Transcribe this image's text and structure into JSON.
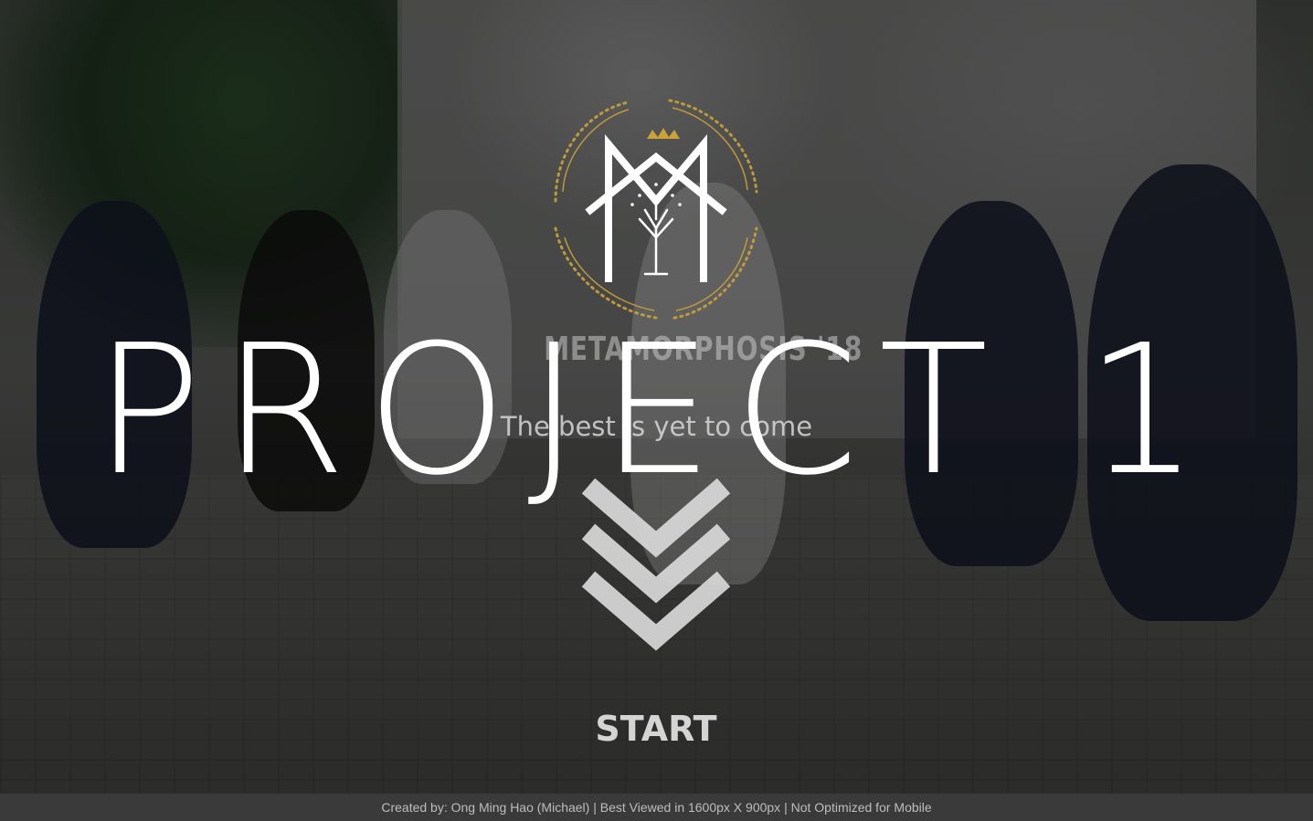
{
  "hero": {
    "title": "PROJECT 1",
    "tagline": "The best is yet to come",
    "logo_subtitle": "METAMORPHOSIS '18"
  },
  "actions": {
    "start_label": "START"
  },
  "footer": {
    "credits": "Created by: Ong Ming Hao (Michael) | Best Viewed in 1600px X 900px | Not Optimized for Mobile"
  },
  "colors": {
    "title": "#ffffff",
    "logo_gold": "#c9a23a",
    "logo_white": "#ffffff",
    "chevron": "#d9d9d9",
    "start": "#d4d4d4",
    "footer_bg": "#3c3c3c",
    "footer_text": "#bdbdbd"
  },
  "icons": {
    "logo": "metamorphosis-tree-crest-icon",
    "scroll_down": "triple-chevron-down-icon"
  }
}
